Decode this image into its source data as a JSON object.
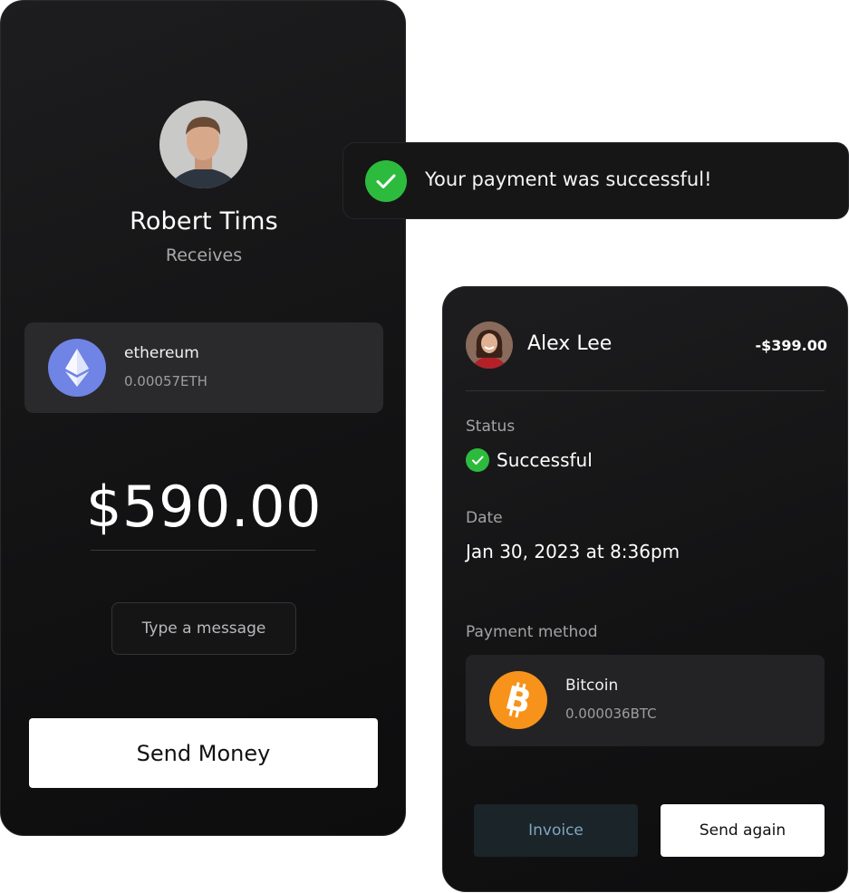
{
  "sender_card": {
    "recipient_name": "Robert Tims",
    "recipient_role": "Receives",
    "coin": {
      "name": "ethereum",
      "amount": "0.00057ETH",
      "icon": "ethereum-icon",
      "color": "#6f84e4"
    },
    "amount": "$590.00",
    "message_button": "Type a message",
    "send_button": "Send Money"
  },
  "toast": {
    "message": "Your payment was successful!",
    "icon": "check-circle-icon",
    "color": "#2dbb3e"
  },
  "receipt_card": {
    "name": "Alex Lee",
    "amount": "-$399.00",
    "status_label": "Status",
    "status_value": "Successful",
    "date_label": "Date",
    "date_value": "Jan 30, 2023 at 8:36pm",
    "payment_method_label": "Payment method",
    "payment_method": {
      "name": "Bitcoin",
      "amount": "0.000036BTC",
      "icon": "bitcoin-icon",
      "color": "#f7931a"
    },
    "invoice_button": "Invoice",
    "send_again_button": "Send again"
  }
}
